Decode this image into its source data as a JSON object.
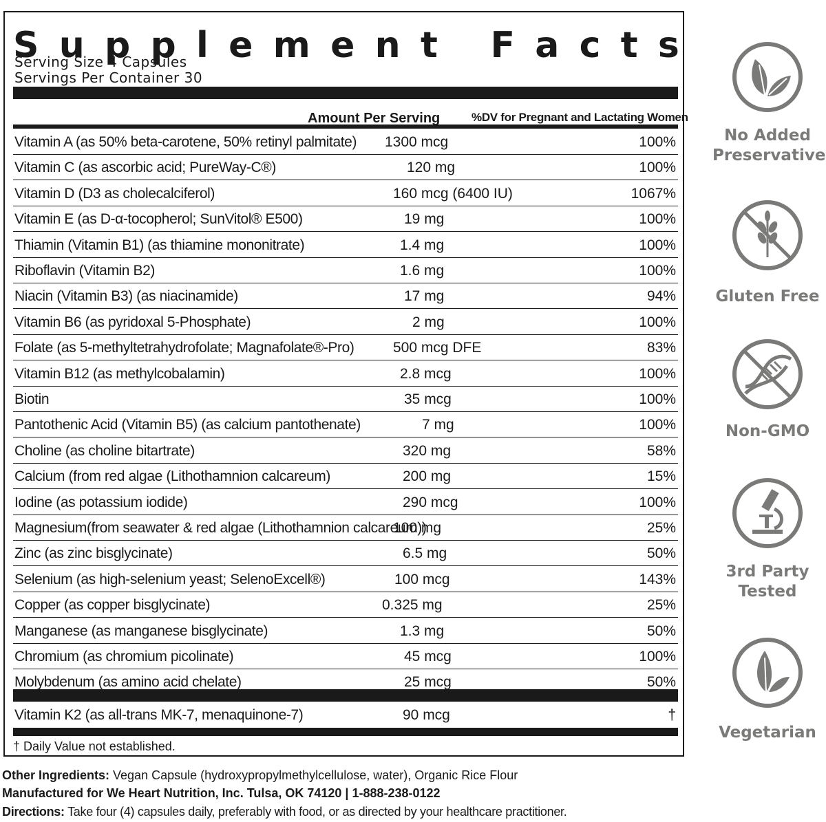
{
  "title": "Supplement Facts",
  "serving_size": "Serving Size 4 Capsules",
  "servings_per_container": "Servings Per Container 30",
  "header": {
    "amount": "Amount Per Serving",
    "dv": "%DV for Pregnant and Lactating Women"
  },
  "nutrients": [
    {
      "name": "Vitamin A (as 50% beta-carotene, 50% retinyl palmitate)",
      "amount": "1300 mcg",
      "dv": "100%"
    },
    {
      "name": "Vitamin C  (as ascorbic acid; PureWay-C®)",
      "amount": "120 mg",
      "dv": "100%"
    },
    {
      "name": "Vitamin D (D3 as cholecalciferol)",
      "amount": "160 mcg (6400 IU)",
      "dv": "1067%"
    },
    {
      "name": "Vitamin E (as D-α-tocopherol; SunVitol® E500)",
      "amount": "19 mg",
      "dv": "100%"
    },
    {
      "name": "Thiamin (Vitamin B1) (as thiamine mononitrate)",
      "amount": "1.4 mg",
      "dv": "100%"
    },
    {
      "name": "Riboflavin (Vitamin B2)",
      "amount": "1.6 mg",
      "dv": "100%"
    },
    {
      "name": "Niacin (Vitamin B3) (as niacinamide)",
      "amount": "17 mg",
      "dv": "94%"
    },
    {
      "name": "Vitamin B6 (as pyridoxal 5-Phosphate)",
      "amount": "2 mg",
      "dv": "100%"
    },
    {
      "name": "Folate  (as 5-methyltetrahydrofolate; Magnafolate®-Pro)",
      "amount": "500 mcg DFE",
      "dv": "83%"
    },
    {
      "name": "Vitamin B12  (as methylcobalamin)",
      "amount": "2.8 mcg",
      "dv": "100%"
    },
    {
      "name": "Biotin",
      "amount": "35 mcg",
      "dv": "100%"
    },
    {
      "name": "Pantothenic Acid (Vitamin B5) (as calcium pantothenate)",
      "amount": "7 mg",
      "dv": "100%"
    },
    {
      "name": "Choline (as choline bitartrate)",
      "amount": "320 mg",
      "dv": "58%"
    },
    {
      "name": "Calcium (from red algae (Lithothamnion calcareum)",
      "amount": "200 mg",
      "dv": "15%"
    },
    {
      "name": "Iodine (as potassium iodide)",
      "amount": "290 mcg",
      "dv": "100%"
    },
    {
      "name": "Magnesium(from seawater & red algae (Lithothamnion calcareum))",
      "amount": "100 mg",
      "dv": "25%"
    },
    {
      "name": "Zinc (as zinc bisglycinate)",
      "amount": "6.5 mg",
      "dv": "50%"
    },
    {
      "name": "Selenium (as high-selenium yeast; SelenoExcell®)",
      "amount": "100 mcg",
      "dv": "143%"
    },
    {
      "name": "Copper (as copper bisglycinate)",
      "amount": "0.325 mg",
      "dv": "25%"
    },
    {
      "name": "Manganese (as manganese bisglycinate)",
      "amount": "1.3 mg",
      "dv": "50%"
    },
    {
      "name": "Chromium (as chromium picolinate)",
      "amount": "45 mcg",
      "dv": "100%"
    },
    {
      "name": "Molybdenum (as amino acid chelate)",
      "amount": "25 mcg",
      "dv": "50%"
    }
  ],
  "extra": {
    "name": "Vitamin K2 (as all-trans MK-7, menaquinone-7)",
    "amount": "90 mcg",
    "dv": "†"
  },
  "footnote": "† Daily Value not established.",
  "other_ingredients": {
    "label": "Other Ingredients:",
    "text": " Vegan Capsule (hydroxypropylmethylcellulose, water), Organic Rice Flour"
  },
  "manufacturer": "Manufactured for We Heart Nutrition, Inc. Tulsa, OK 74120 | 1-888-238-0122",
  "directions": {
    "label": "Directions:",
    "text": " Take four (4) capsules daily, preferably with food, or as directed by your healthcare practitioner."
  },
  "badges": [
    {
      "icon": "leaves-icon",
      "line1": "No Added",
      "line2": "Preservatives"
    },
    {
      "icon": "wheat-crossed-icon",
      "line1": "Gluten Free",
      "line2": ""
    },
    {
      "icon": "dna-crossed-icon",
      "line1": "Non-GMO",
      "line2": ""
    },
    {
      "icon": "microscope-icon",
      "line1": "3rd Party",
      "line2": "Tested"
    },
    {
      "icon": "leaf-icon",
      "line1": "Vegetarian",
      "line2": ""
    }
  ],
  "colors": {
    "ink": "#1a1a1a",
    "badge_gray": "#7a7a78"
  }
}
